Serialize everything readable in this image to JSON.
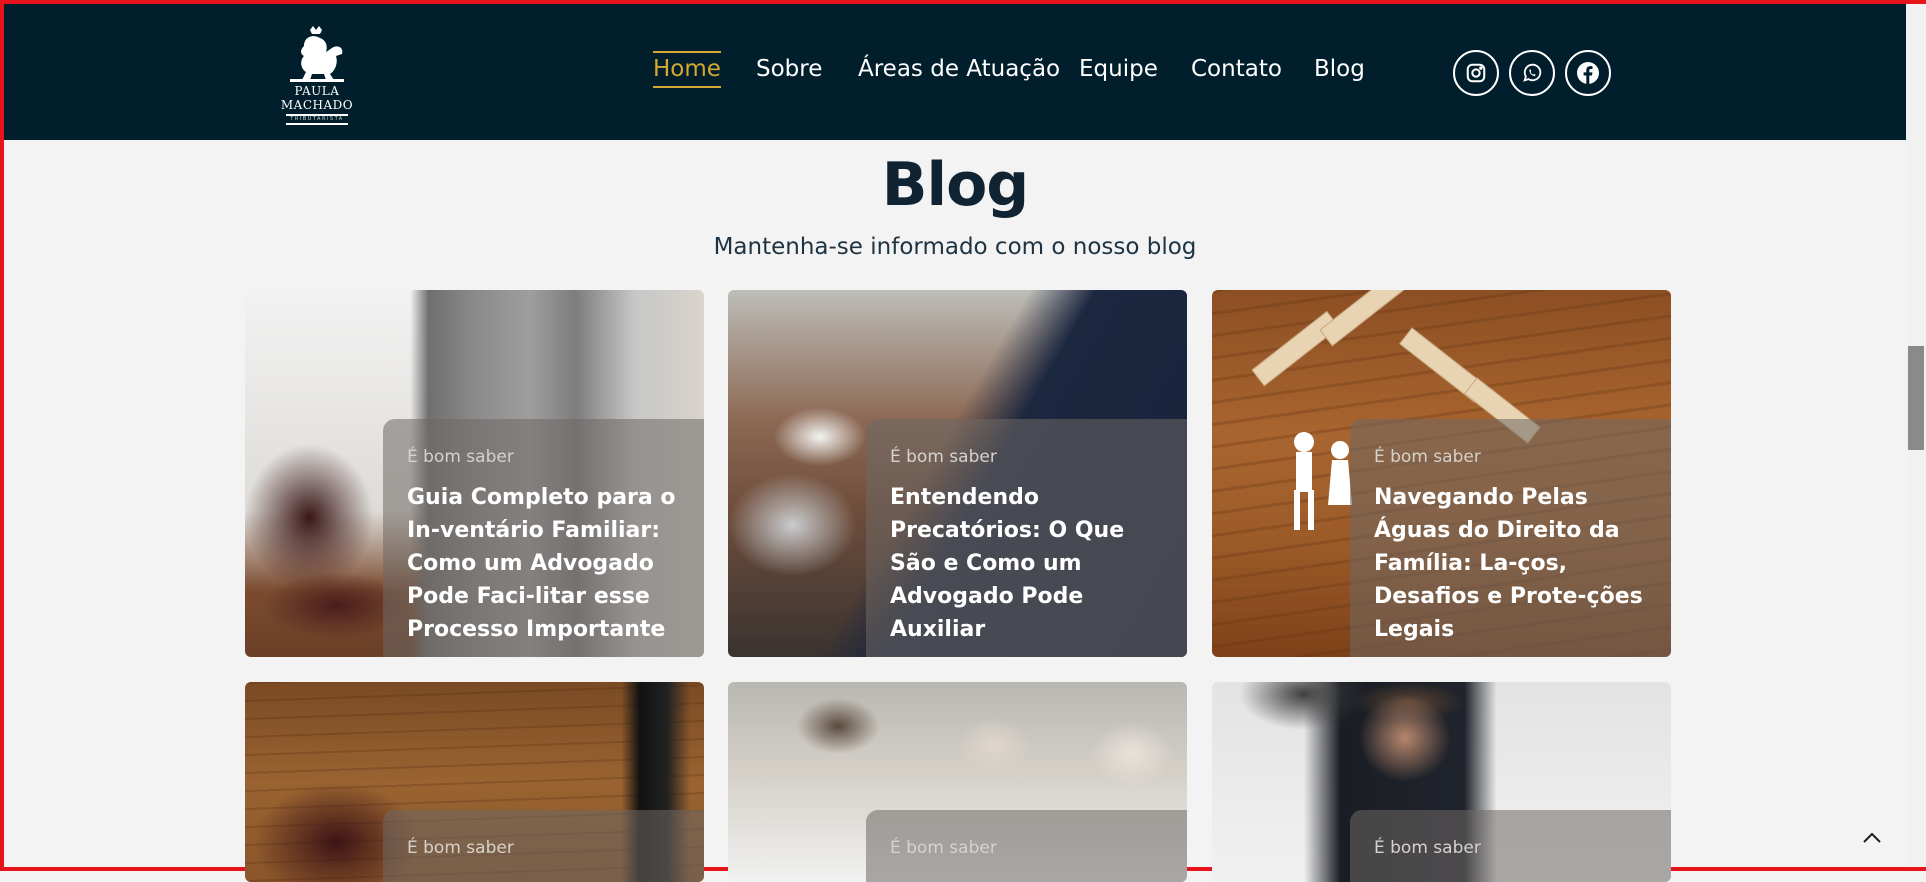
{
  "brand": {
    "name": "PAULA MACHADO",
    "tagline": "TRIBUTARISTA"
  },
  "nav": [
    "Home",
    "Sobre",
    "Áreas de Atuação",
    "Equipe",
    "Contato",
    "Blog"
  ],
  "active_nav": "Home",
  "social": [
    "instagram-icon",
    "whatsapp-icon",
    "facebook-icon"
  ],
  "colors": {
    "header_bg": "#001e2b",
    "accent": "#d5a734",
    "page_bg": "#f3f3f3",
    "border": "#e8141c"
  },
  "section": {
    "title": "Blog",
    "subtitle": "Mantenha-se informado com o nosso blog"
  },
  "posts": [
    {
      "tag": "É bom saber",
      "title": "Guia Completo para o In-ventário Familiar: Como um Advogado Pode Faci-litar esse Processo Importante"
    },
    {
      "tag": "É bom saber",
      "title": "Entendendo Precatórios: O Que São e Como um Advogado Pode Auxiliar"
    },
    {
      "tag": "É bom saber",
      "title": "Navegando Pelas Águas do Direito da Família: La-ços, Desafios e Prote-ções Legais"
    },
    {
      "tag": "É bom saber",
      "title": ""
    },
    {
      "tag": "É bom saber",
      "title": ""
    },
    {
      "tag": "É bom saber",
      "title": ""
    }
  ]
}
